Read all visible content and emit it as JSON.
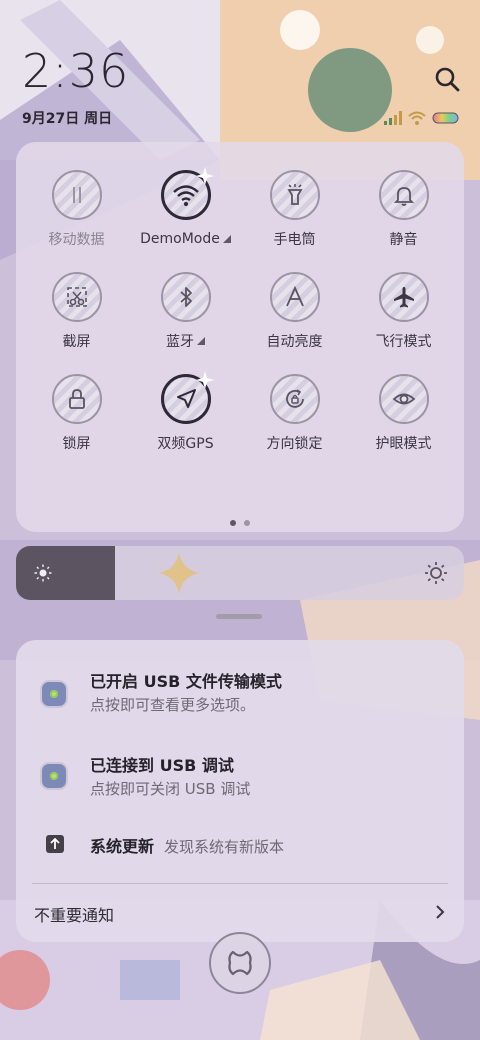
{
  "status": {
    "time": "2:36",
    "date": "9月27日 周日",
    "search_icon": "search-icon",
    "wifi_icon": "wifi-icon",
    "signal_icon": "signal-icon",
    "battery_icon": "battery-icon"
  },
  "quick_settings": {
    "tiles": [
      {
        "label": "移动数据",
        "icon": "mobile-data-icon",
        "active": false
      },
      {
        "label": "DemoMode",
        "icon": "wifi-icon",
        "active": true,
        "has_dropdown": true
      },
      {
        "label": "手电筒",
        "icon": "flashlight-icon",
        "active": false
      },
      {
        "label": "静音",
        "icon": "bell-icon",
        "active": false
      },
      {
        "label": "截屏",
        "icon": "screenshot-icon",
        "active": false
      },
      {
        "label": "蓝牙",
        "icon": "bluetooth-icon",
        "active": false,
        "has_dropdown": true
      },
      {
        "label": "自动亮度",
        "icon": "auto-brightness-icon",
        "active": false
      },
      {
        "label": "飞行模式",
        "icon": "airplane-icon",
        "active": false
      },
      {
        "label": "锁屏",
        "icon": "lock-icon",
        "active": false
      },
      {
        "label": "双频GPS",
        "icon": "location-arrow-icon",
        "active": true
      },
      {
        "label": "方向锁定",
        "icon": "rotation-lock-icon",
        "active": false
      },
      {
        "label": "护眼模式",
        "icon": "eye-icon",
        "active": false
      }
    ],
    "page_count": 2,
    "current_page": 1
  },
  "brightness": {
    "level": 0.22
  },
  "notifications": {
    "usb_transfer": {
      "title": "已开启 USB 文件传输模式",
      "subtitle": "点按即可查看更多选项。"
    },
    "usb_debug": {
      "title": "已连接到 USB 调试",
      "subtitle": "点按即可关闭 USB 调试"
    },
    "system_update": {
      "title": "系统更新",
      "subtitle": "发现系统有新版本"
    },
    "unimportant_label": "不重要通知"
  },
  "clear_all_icon": "close-icon",
  "colors": {
    "panel": "#e2dae9",
    "active_ring": "#2f2838",
    "brightness_fill": "#5c5561",
    "text_primary": "#26212b",
    "text_secondary": "#6f6875"
  }
}
